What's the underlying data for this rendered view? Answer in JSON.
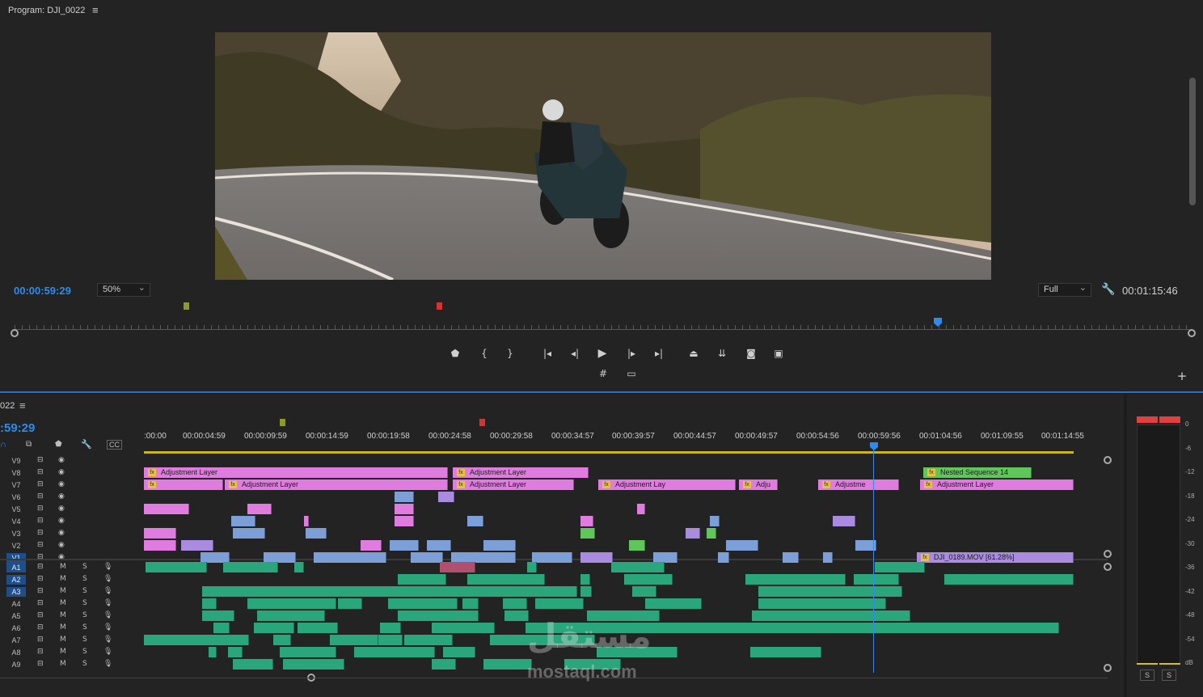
{
  "program_panel": {
    "title": "Program: DJI_0022",
    "current_time": "00:00:59:29",
    "zoom": "50%",
    "resolution": "Full",
    "duration": "00:01:15:46",
    "playhead_fraction": 0.787
  },
  "transport_icons": [
    "marker-icon",
    "mark-in-icon",
    "mark-out-icon",
    "go-to-in-icon",
    "step-back-icon",
    "play-icon",
    "step-forward-icon",
    "go-to-out-icon",
    "lift-icon",
    "extract-icon",
    "export-frame-icon",
    "compare-view-icon"
  ],
  "timeline": {
    "tab_label": "022",
    "timecode": ":59:29",
    "ruler_labels": [
      ":00:00",
      "00:00:04:59",
      "00:00:09:59",
      "00:00:14:59",
      "00:00:19:58",
      "00:00:24:58",
      "00:00:29:58",
      "00:00:34:57",
      "00:00:39:57",
      "00:00:44:57",
      "00:00:49:57",
      "00:00:54:56",
      "00:00:59:56",
      "00:01:04:56",
      "00:01:09:55",
      "00:01:14:55"
    ],
    "video_tracks": [
      "V9",
      "V8",
      "V7",
      "V6",
      "V5",
      "V4",
      "V3",
      "V2",
      "V1"
    ],
    "audio_tracks": [
      "A1",
      "A2",
      "A3",
      "A4",
      "A5",
      "A6",
      "A7",
      "A8",
      "A9"
    ],
    "track_toggles": {
      "mute": "M",
      "solo": "S"
    },
    "clip_labels": {
      "adjustment": "Adjustment Layer",
      "adjustment_short1": "Adjustment Lay",
      "adjustment_short2": "Adju",
      "adjustment_short3": "Adjustme",
      "nested": "Nested Sequence 14",
      "v1_clip": "DJI_0189.MOV [61.28%]",
      "fx": "fx"
    }
  },
  "audio_meter": {
    "scale": [
      "0",
      "-6",
      "-12",
      "-18",
      "-24",
      "-30",
      "-36",
      "-42",
      "-48",
      "-54",
      "dB"
    ],
    "solo_labels": [
      "S",
      "S"
    ]
  },
  "colors": {
    "timecode": "#2d8ceb",
    "adjustment_clip": "#e07be0",
    "video_clip": "#7c9fd8",
    "audio_clip": "#2aa67c",
    "nested_clip": "#5fc75a",
    "purple_clip": "#a98be0"
  },
  "watermark": {
    "arabic": "مستقل",
    "latin": "mostaql.com"
  }
}
